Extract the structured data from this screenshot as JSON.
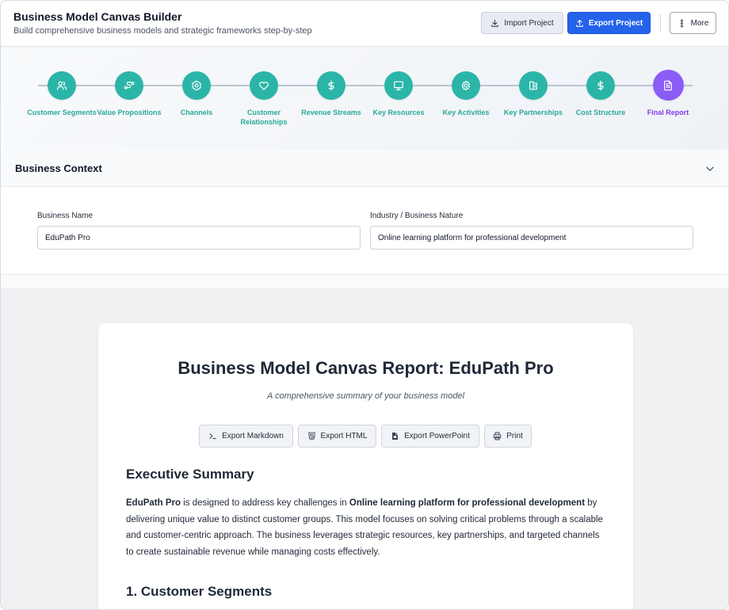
{
  "header": {
    "title": "Business Model Canvas Builder",
    "subtitle": "Build comprehensive business models and strategic frameworks step-by-step",
    "import_label": "Import Project",
    "export_label": "Export Project",
    "more_label": "More"
  },
  "steps": [
    {
      "label": "Customer Segments",
      "icon": "users-icon"
    },
    {
      "label": "Value Propositions",
      "icon": "route-icon"
    },
    {
      "label": "Channels",
      "icon": "channels-icon"
    },
    {
      "label": "Customer Relationships",
      "icon": "heart-icon"
    },
    {
      "label": "Revenue Streams",
      "icon": "dollar-icon"
    },
    {
      "label": "Key Resources",
      "icon": "monitor-icon"
    },
    {
      "label": "Key Activities",
      "icon": "gear-icon"
    },
    {
      "label": "Key Partnerships",
      "icon": "partnership-icon"
    },
    {
      "label": "Cost Structure",
      "icon": "dollar-icon"
    },
    {
      "label": "Final Report",
      "icon": "document-icon",
      "active": true
    }
  ],
  "context": {
    "title": "Business Context",
    "business_name_label": "Business Name",
    "business_name_value": "EduPath Pro",
    "industry_label": "Industry / Business Nature",
    "industry_value": "Online learning platform for professional development"
  },
  "report": {
    "title": "Business Model Canvas Report: EduPath Pro",
    "subtitle": "A comprehensive summary of your business model",
    "export_buttons": {
      "markdown": "Export Markdown",
      "html": "Export HTML",
      "powerpoint": "Export PowerPoint",
      "print": "Print"
    },
    "exec_heading": "Executive Summary",
    "summary": {
      "name": "EduPath Pro",
      "t1": " is designed to address key challenges in ",
      "industry": "Online learning platform for professional development",
      "t2": " by delivering unique value to distinct customer groups. This model focuses on solving critical problems through a scalable and customer-centric approach. The business leverages strategic resources, key partnerships, and targeted channels to create sustainable revenue while managing costs effectively."
    },
    "section1_heading": "1. Customer Segments"
  },
  "colors": {
    "step_complete": "#2bb5a8",
    "step_active": "#8b5cf6",
    "primary": "#2563eb"
  }
}
